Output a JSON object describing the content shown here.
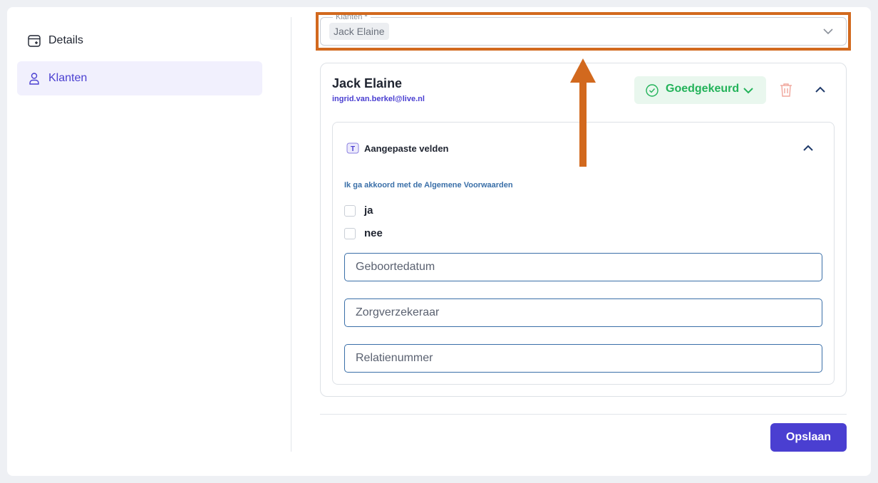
{
  "sidebar": {
    "items": [
      {
        "label": "Details",
        "icon": "calendar-plus-icon",
        "active": false
      },
      {
        "label": "Klanten",
        "icon": "user-icon",
        "active": true
      }
    ]
  },
  "client_select": {
    "legend": "Klanten *",
    "selected": "Jack Elaine"
  },
  "client": {
    "name": "Jack Elaine",
    "email": "ingrid.van.berkel@live.nl",
    "status": "Goedgekeurd"
  },
  "custom_fields": {
    "title": "Aangepaste velden",
    "terms_label": "Ik ga akkoord met de Algemene Voorwaarden",
    "options": [
      "ja",
      "nee"
    ],
    "inputs": [
      {
        "placeholder": "Geboortedatum",
        "value": ""
      },
      {
        "placeholder": "Zorgverzekeraar",
        "value": ""
      },
      {
        "placeholder": "Relatienummer",
        "value": ""
      }
    ]
  },
  "actions": {
    "save_label": "Opslaan"
  },
  "colors": {
    "accent": "#4a3fd1",
    "status_green": "#23b35a",
    "annotation": "#d2691e"
  }
}
